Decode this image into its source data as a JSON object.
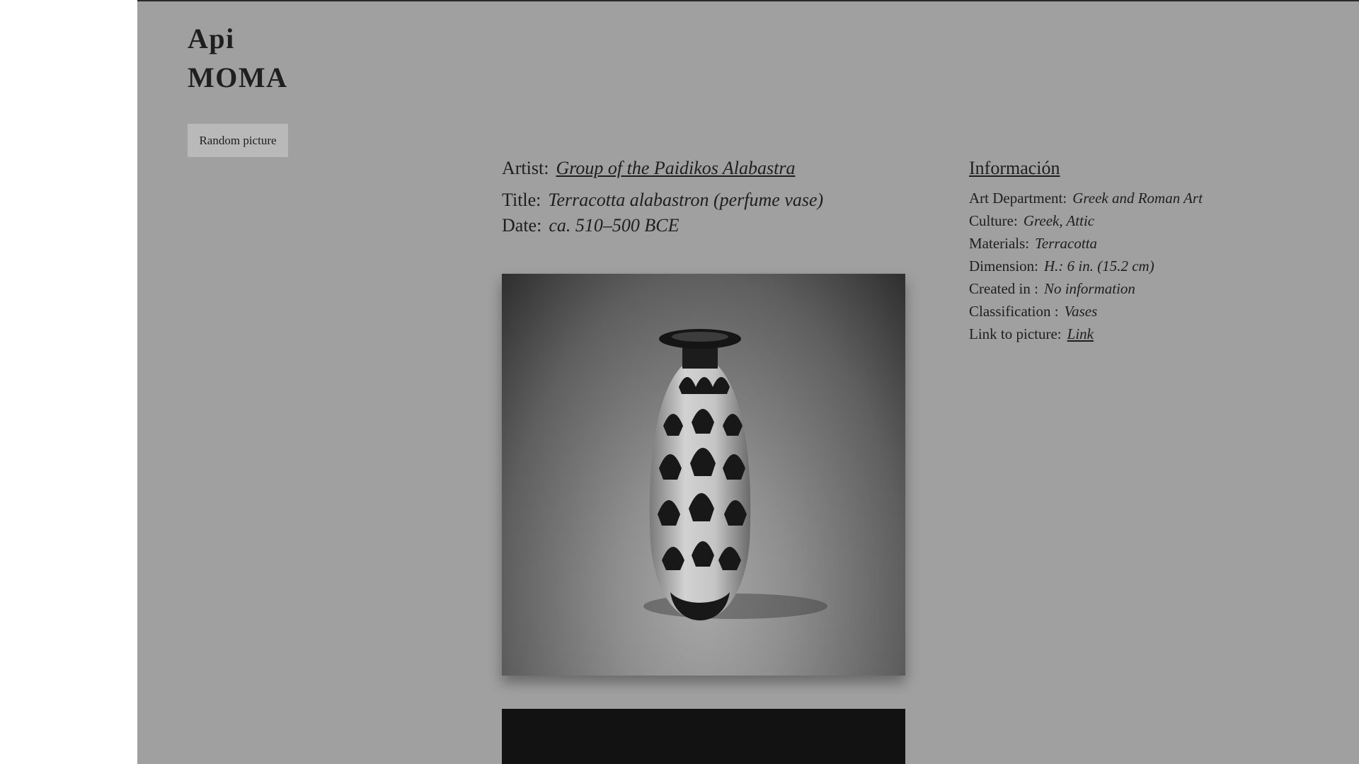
{
  "brand": {
    "line1": "Api",
    "line2": "MOMA"
  },
  "random_button": {
    "label": "Random picture"
  },
  "artwork": {
    "artist_label": "Artist:",
    "artist": "Group of the Paidikos Alabastra",
    "title_label": "Title:",
    "title": "Terracotta alabastron (perfume vase)",
    "date_label": "Date:",
    "date": "ca. 510–500 BCE",
    "image_subject": "vase"
  },
  "info": {
    "heading": "Información",
    "rows": [
      {
        "label": "Art Department:",
        "value": "Greek and Roman Art"
      },
      {
        "label": "Culture:",
        "value": "Greek, Attic"
      },
      {
        "label": "Materials:",
        "value": "Terracotta"
      },
      {
        "label": "Dimension:",
        "value": "H.: 6 in. (15.2 cm)"
      },
      {
        "label": "Created in :",
        "value": "No information"
      },
      {
        "label": "Classification :",
        "value": "Vases"
      },
      {
        "label": "Link to picture:",
        "value": "Link"
      }
    ]
  },
  "colors": {
    "page_background": "#a0a0a0",
    "left_margin": "#ffffff",
    "button_background": "#b9b9b9",
    "text": "#1e1e1e"
  }
}
